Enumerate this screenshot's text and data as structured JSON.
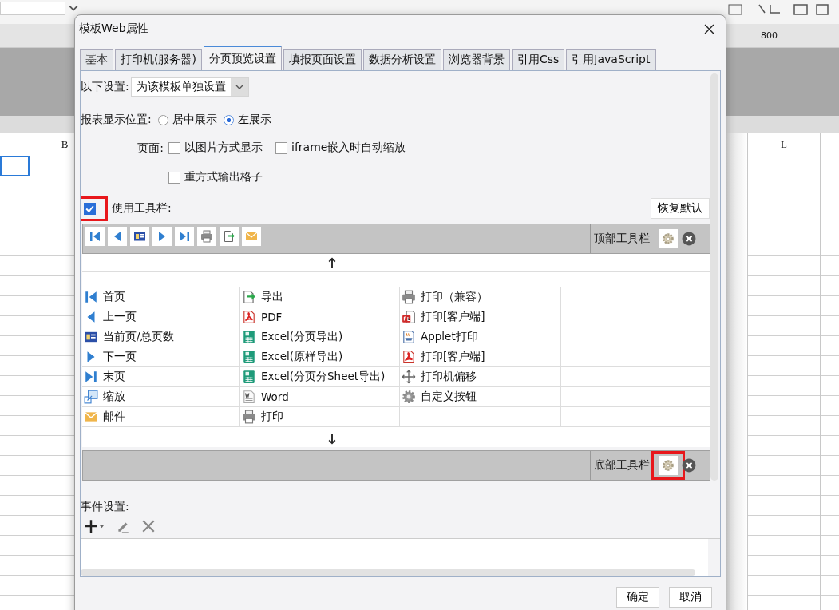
{
  "background": {
    "ruler_label": "800",
    "column_headers": [
      "B",
      "L"
    ]
  },
  "window": {
    "title": "模板Web属性"
  },
  "tabs": [
    {
      "label": "基本",
      "selected": false
    },
    {
      "label": "打印机(服务器)",
      "selected": false
    },
    {
      "label": "分页预览设置",
      "selected": true
    },
    {
      "label": "填报页面设置",
      "selected": false
    },
    {
      "label": "数据分析设置",
      "selected": false
    },
    {
      "label": "浏览器背景",
      "selected": false
    },
    {
      "label": "引用Css",
      "selected": false
    },
    {
      "label": "引用JavaScript",
      "selected": false
    }
  ],
  "settings_scope": {
    "label": "以下设置:",
    "value": "为该模板单独设置"
  },
  "display_position": {
    "label": "报表显示位置:",
    "options": [
      {
        "label": "居中展示",
        "selected": false
      },
      {
        "label": "左展示",
        "selected": true
      }
    ]
  },
  "page_options": {
    "label": "页面:",
    "options": [
      {
        "label": "以图片方式显示",
        "checked": false
      },
      {
        "label": "iframe嵌入时自动缩放",
        "checked": false
      },
      {
        "label": "重方式输出格子",
        "checked": false
      }
    ]
  },
  "use_toolbar": {
    "label": "使用工具栏:",
    "checked": true,
    "highlighted": true
  },
  "restore_button": "恢复默认",
  "top_toolbar": {
    "label": "顶部工具栏",
    "settings_highlighted": false,
    "buttons": [
      {
        "kind": "first"
      },
      {
        "kind": "prev"
      },
      {
        "kind": "page"
      },
      {
        "kind": "next"
      },
      {
        "kind": "last"
      },
      {
        "kind": "print"
      },
      {
        "kind": "export"
      },
      {
        "kind": "mail"
      }
    ]
  },
  "button_grid": {
    "columns": [
      [
        {
          "kind": "first",
          "label": "首页"
        },
        {
          "kind": "prev",
          "label": "上一页"
        },
        {
          "kind": "page",
          "label": "当前页/总页数"
        },
        {
          "kind": "next",
          "label": "下一页"
        },
        {
          "kind": "last",
          "label": "末页"
        },
        {
          "kind": "zoom",
          "label": "缩放"
        },
        {
          "kind": "mail",
          "label": "邮件"
        }
      ],
      [
        {
          "kind": "export",
          "label": "导出"
        },
        {
          "kind": "pdf",
          "label": "PDF"
        },
        {
          "kind": "excel",
          "label": "Excel(分页导出)"
        },
        {
          "kind": "excel",
          "label": "Excel(原样导出)"
        },
        {
          "kind": "excel",
          "label": "Excel(分页分Sheet导出)"
        },
        {
          "kind": "word",
          "label": "Word"
        },
        {
          "kind": "print",
          "label": "打印"
        }
      ],
      [
        {
          "kind": "print",
          "label": "打印（兼容）"
        },
        {
          "kind": "flash",
          "label": "打印[客户端]"
        },
        {
          "kind": "applet",
          "label": "Applet打印"
        },
        {
          "kind": "pdf",
          "label": "打印[客户端]"
        },
        {
          "kind": "move",
          "label": "打印机偏移"
        },
        {
          "kind": "gear",
          "label": "自定义按钮"
        }
      ]
    ]
  },
  "bottom_toolbar": {
    "label": "底部工具栏",
    "settings_highlighted": true
  },
  "events": {
    "label": "事件设置:"
  },
  "buttons": [
    "确定",
    "取消"
  ]
}
